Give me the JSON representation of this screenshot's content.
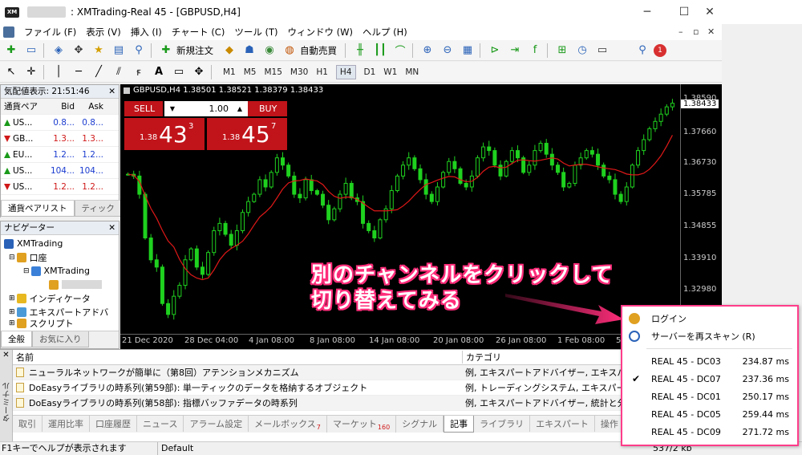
{
  "window": {
    "title": ": XMTrading-Real 45 - [GBPUSD,H4]",
    "minimize": "─",
    "maximize": "☐",
    "close": "✕"
  },
  "menu": [
    "ファイル (F)",
    "表示 (V)",
    "挿入 (I)",
    "チャート (C)",
    "ツール (T)",
    "ウィンドウ (W)",
    "ヘルプ (H)"
  ],
  "mdi": {
    "min": "–",
    "restore": "▫",
    "close": "✕"
  },
  "toolbar1": {
    "new_order": "新規注文",
    "auto_trading": "自動売買"
  },
  "timeframes": [
    "M1",
    "M5",
    "M15",
    "M30",
    "H1",
    "H4",
    "D1",
    "W1",
    "MN"
  ],
  "active_timeframe": "H4",
  "market_watch": {
    "title": "気配値表示: 21:51:46",
    "headers": [
      "通貨ペア",
      "Bid",
      "Ask"
    ],
    "rows": [
      {
        "symbol": "US...",
        "bid": "0.8...",
        "ask": "0.8...",
        "dir": "up"
      },
      {
        "symbol": "GB...",
        "bid": "1.3...",
        "ask": "1.3...",
        "dir": "dn"
      },
      {
        "symbol": "EU...",
        "bid": "1.2...",
        "ask": "1.2...",
        "dir": "up"
      },
      {
        "symbol": "US...",
        "bid": "104...",
        "ask": "104...",
        "dir": "up"
      },
      {
        "symbol": "US...",
        "bid": "1.2...",
        "ask": "1.2...",
        "dir": "dn"
      }
    ],
    "tabs": [
      "通貨ペアリスト",
      "ティック"
    ]
  },
  "navigator": {
    "title": "ナビゲーター",
    "items": [
      "XMTrading",
      "口座",
      "XMTrading",
      "インディケータ",
      "エキスパートアドバ",
      "スクリプト"
    ],
    "tabs": [
      "全般",
      "お気に入り"
    ]
  },
  "chart": {
    "header": "GBPUSD,H4  1.38501 1.38521 1.38379 1.38433",
    "one_click": {
      "sell": "SELL",
      "buy": "BUY",
      "lot": "1.00",
      "sell_small": "1.38",
      "sell_big": "43",
      "sell_sup": "3",
      "buy_small": "1.38",
      "buy_big": "45",
      "buy_sup": "7"
    },
    "price_labels": [
      "1.38590",
      "1.37660",
      "1.36730",
      "1.35785",
      "1.34855",
      "1.33910",
      "1.32980"
    ],
    "current_price": "1.38433",
    "date_labels": [
      "21 Dec 2020",
      "28 Dec 04:00",
      "4 Jan 08:00",
      "8 Jan 08:00",
      "14 Jan 08:00",
      "20 Jan 08:00",
      "26 Jan 08:00",
      "1 Feb 08:00",
      "5"
    ]
  },
  "annotation": {
    "line1": "別のチャンネルをクリックして",
    "line2": "切り替えてみる",
    "color": "#ff2d7a"
  },
  "server_popup": {
    "login": "ログイン",
    "rescan": "サーバーを再スキャン (R)",
    "servers": [
      {
        "name": "REAL 45 - DC03",
        "ping": "234.87 ms",
        "checked": false
      },
      {
        "name": "REAL 45 - DC07",
        "ping": "237.36 ms",
        "checked": true
      },
      {
        "name": "REAL 45 - DC01",
        "ping": "250.17 ms",
        "checked": false
      },
      {
        "name": "REAL 45 - DC05",
        "ping": "259.44 ms",
        "checked": false
      },
      {
        "name": "REAL 45 - DC09",
        "ping": "271.72 ms",
        "checked": false
      }
    ]
  },
  "terminal": {
    "side_label": "ターミナル",
    "col_name": "名前",
    "col_category": "カテゴリ",
    "rows": [
      {
        "name": "ニューラルネットワークが簡単に（第8回）アテンションメカニズム",
        "category": "例, エキスパートアドバイザー, エキスパート, 統"
      },
      {
        "name": "DoEasyライブラリの時系列(第59部): 単一ティックのデータを格納するオブジェクト",
        "category": "例, トレーディングシステム, エキスパートアド"
      },
      {
        "name": "DoEasyライブラリの時系列(第58部): 指標バッファデータの時系列",
        "category": "例, エキスパートアドバイザー, 統計と分析"
      }
    ],
    "tabs": [
      {
        "label": "取引",
        "badge": ""
      },
      {
        "label": "運用比率",
        "badge": ""
      },
      {
        "label": "口座履歴",
        "badge": ""
      },
      {
        "label": "ニュース",
        "badge": ""
      },
      {
        "label": "アラーム設定",
        "badge": ""
      },
      {
        "label": "メールボックス",
        "badge": "7"
      },
      {
        "label": "マーケット",
        "badge": "160"
      },
      {
        "label": "シグナル",
        "badge": ""
      },
      {
        "label": "記事",
        "badge": ""
      },
      {
        "label": "ライブラリ",
        "badge": ""
      },
      {
        "label": "エキスパート",
        "badge": ""
      },
      {
        "label": "操作",
        "badge": ""
      }
    ],
    "active_tab": "記事"
  },
  "status": {
    "help": "F1キーでヘルプが表示されます",
    "profile": "Default",
    "traffic": "537/2 kb"
  },
  "candles": [
    1.3655,
    1.365,
    1.36,
    1.348,
    1.342,
    1.34,
    1.33,
    1.327,
    1.332,
    1.335,
    1.342,
    1.345,
    1.34,
    1.338,
    1.344,
    1.35,
    1.352,
    1.349,
    1.346,
    1.35,
    1.355,
    1.358,
    1.36,
    1.364,
    1.362,
    1.366,
    1.37,
    1.368,
    1.365,
    1.36,
    1.359,
    1.364,
    1.361,
    1.36,
    1.357,
    1.353,
    1.356,
    1.36,
    1.363,
    1.359,
    1.358,
    1.352,
    1.35,
    1.348,
    1.353,
    1.356,
    1.361,
    1.365,
    1.368,
    1.37,
    1.367,
    1.364,
    1.36,
    1.358,
    1.362,
    1.366,
    1.369,
    1.367,
    1.363,
    1.362,
    1.365,
    1.37,
    1.373,
    1.372,
    1.368,
    1.365,
    1.369,
    1.372,
    1.37,
    1.366,
    1.368,
    1.372,
    1.374,
    1.371,
    1.368,
    1.366,
    1.362,
    1.363,
    1.368,
    1.37,
    1.372,
    1.371,
    1.368,
    1.365,
    1.364,
    1.36,
    1.358,
    1.362,
    1.368,
    1.372,
    1.375,
    1.378,
    1.38,
    1.382,
    1.384,
    1.385
  ]
}
